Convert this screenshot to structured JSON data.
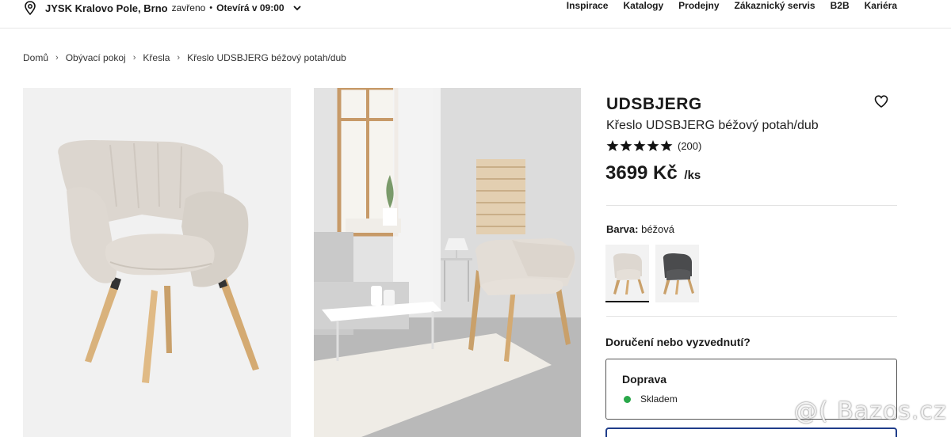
{
  "header": {
    "store_name": "JYSK Kralovo Pole, Brno",
    "store_status": "zavřeno",
    "separator": "•",
    "opens": "Otevírá v 09:00",
    "nav": [
      "Inspirace",
      "Katalogy",
      "Prodejny",
      "Zákaznický servis",
      "B2B",
      "Kariéra"
    ]
  },
  "breadcrumb": [
    "Domů",
    "Obývací pokoj",
    "Křesla",
    "Křeslo UDSBJERG béžový potah/dub"
  ],
  "product": {
    "title": "UDSBJERG",
    "subtitle": "Křeslo UDSBJERG béžový potah/dub",
    "rating_stars": 5,
    "rating_count": "(200)",
    "price": "3699 Kč",
    "price_unit": "/ks",
    "color_label": "Barva:",
    "color_value": "béžová",
    "swatches": [
      {
        "name": "béžová",
        "color": "#d9d3cc",
        "selected": true
      },
      {
        "name": "šedá",
        "color": "#4a4b4d",
        "selected": false
      }
    ]
  },
  "delivery": {
    "heading": "Doručení nebo vyzvednutí?",
    "option_title": "Doprava",
    "stock_text": "Skladem",
    "stock_color": "#2aa84a"
  },
  "watermark": "@( Bazos.cz"
}
